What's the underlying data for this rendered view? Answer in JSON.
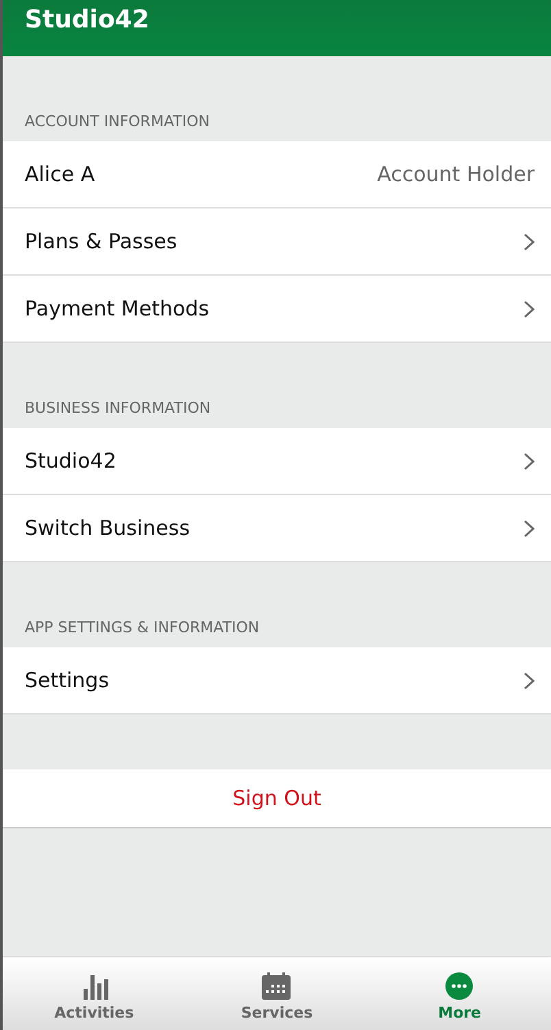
{
  "header": {
    "title": "Studio42"
  },
  "sections": [
    {
      "title": "ACCOUNT INFORMATION",
      "rows": [
        {
          "kind": "detail",
          "label": "Alice A",
          "value": "Account Holder"
        },
        {
          "kind": "link",
          "label": "Plans & Passes"
        },
        {
          "kind": "link",
          "label": "Payment Methods"
        }
      ]
    },
    {
      "title": "BUSINESS INFORMATION",
      "rows": [
        {
          "kind": "link",
          "label": "Studio42"
        },
        {
          "kind": "link",
          "label": "Switch Business"
        }
      ]
    },
    {
      "title": "APP SETTINGS & INFORMATION",
      "rows": [
        {
          "kind": "link",
          "label": "Settings"
        }
      ]
    }
  ],
  "sign_out": {
    "label": "Sign Out"
  },
  "tabs": [
    {
      "kind": "activities",
      "label": "Activities",
      "selected": false
    },
    {
      "kind": "services",
      "label": "Services",
      "selected": false
    },
    {
      "kind": "more",
      "label": "More",
      "selected": true
    }
  ]
}
